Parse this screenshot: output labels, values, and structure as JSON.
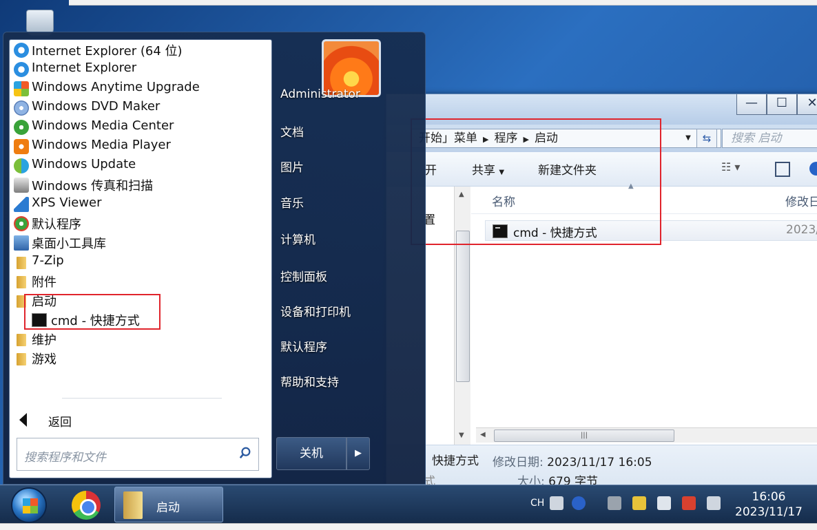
{
  "start_menu": {
    "programs": [
      {
        "label": "Internet Explorer (64 位)",
        "icon": "ie-icon"
      },
      {
        "label": "Internet Explorer",
        "icon": "ie-icon"
      },
      {
        "label": "Windows Anytime Upgrade",
        "icon": "anytime-upgrade-icon"
      },
      {
        "label": "Windows DVD Maker",
        "icon": "dvd-maker-icon"
      },
      {
        "label": "Windows Media Center",
        "icon": "media-center-icon"
      },
      {
        "label": "Windows Media Player",
        "icon": "media-player-icon"
      },
      {
        "label": "Windows Update",
        "icon": "windows-update-icon"
      },
      {
        "label": "Windows 传真和扫描",
        "icon": "fax-scan-icon"
      },
      {
        "label": "XPS Viewer",
        "icon": "xps-viewer-icon"
      },
      {
        "label": "默认程序",
        "icon": "default-programs-icon"
      },
      {
        "label": "桌面小工具库",
        "icon": "gadgets-icon"
      },
      {
        "label": "7-Zip",
        "icon": "folder-icon"
      },
      {
        "label": "附件",
        "icon": "folder-icon"
      },
      {
        "label": "启动",
        "icon": "folder-icon"
      }
    ],
    "startup_sub": "cmd - 快捷方式",
    "more_folders": [
      "维护",
      "游戏"
    ],
    "back": "返回",
    "search_placeholder": "搜索程序和文件",
    "user": "Administrator",
    "right_items": [
      "文档",
      "图片",
      "音乐",
      "计算机",
      "控制面板",
      "设备和打印机",
      "默认程序",
      "帮助和支持"
    ],
    "shutdown": "关机"
  },
  "explorer": {
    "path": [
      "开始」菜单",
      "程序",
      "启动"
    ],
    "search_placeholder": "搜索 启动",
    "toolbar": {
      "open": "开",
      "share": "共享",
      "new_folder": "新建文件夹"
    },
    "left_fragment": "置",
    "columns": {
      "name": "名称",
      "date": "修改日"
    },
    "file": {
      "name": "cmd - 快捷方式",
      "date": "2023/"
    },
    "details": {
      "name": "快捷方式",
      "modified_label": "修改日期:",
      "modified_value": "2023/11/17 16:05",
      "size_label": "大小:",
      "size_value": "679 字节",
      "type_fragment": "式"
    },
    "window_buttons": [
      "—",
      "☐",
      "✕"
    ]
  },
  "taskbar": {
    "task_label": "启动",
    "lang": "CH",
    "time": "16:06",
    "date": "2023/11/17"
  },
  "colors": {
    "highlight": "#e0242c",
    "taskbar": "#1d3658"
  }
}
